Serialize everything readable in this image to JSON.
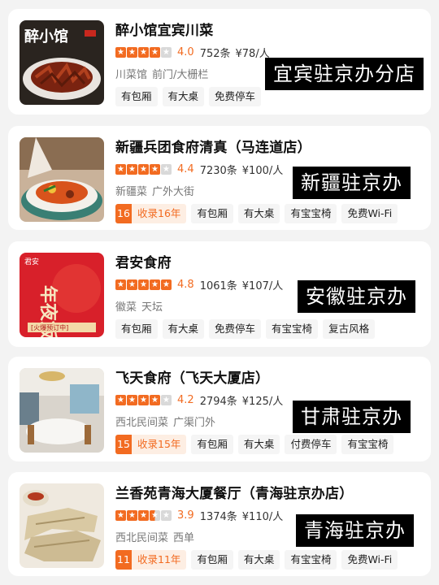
{
  "listings": [
    {
      "name": "醉小馆宜宾川菜",
      "stars": 4,
      "rating": "4.0",
      "reviews": "752条",
      "price": "¥78/人",
      "cuisine": "川菜馆",
      "area": "前门/大栅栏",
      "tags": [
        "有包厢",
        "有大桌",
        "免费停车"
      ],
      "banner": "宜宾驻京办分店",
      "thumb_text": "醉小馆"
    },
    {
      "name": "新疆兵团食府清真（马连道店）",
      "stars": 4,
      "rating": "4.4",
      "reviews": "7230条",
      "price": "¥100/人",
      "cuisine": "新疆菜",
      "area": "广外大街",
      "record_num": "16",
      "record_text": "收录16年",
      "tags": [
        "有包厢",
        "有大桌",
        "有宝宝椅",
        "免费Wi-Fi"
      ],
      "banner": "新疆驻京办"
    },
    {
      "name": "君安食府",
      "stars": 5,
      "rating": "4.8",
      "reviews": "1061条",
      "price": "¥107/人",
      "cuisine": "徽菜",
      "area": "天坛",
      "tags": [
        "有包厢",
        "有大桌",
        "免费停车",
        "有宝宝椅",
        "复古风格"
      ],
      "banner": "安徽驻京办",
      "thumb_text": "年夜飯",
      "thumb_badge": "君安",
      "thumb_caption": "[火爆预订中]"
    },
    {
      "name": "飞天食府（飞天大厦店）",
      "stars": 4,
      "rating": "4.2",
      "reviews": "2794条",
      "price": "¥125/人",
      "cuisine": "西北民间菜",
      "area": "广渠门外",
      "record_num": "15",
      "record_text": "收录15年",
      "tags": [
        "有包厢",
        "有大桌",
        "付费停车",
        "有宝宝椅"
      ],
      "banner": "甘肃驻京办"
    },
    {
      "name": "兰香苑青海大厦餐厅（青海驻京办店）",
      "stars": 3.5,
      "rating": "3.9",
      "reviews": "1374条",
      "price": "¥110/人",
      "cuisine": "西北民间菜",
      "area": "西单",
      "record_num": "11",
      "record_text": "收录11年",
      "tags": [
        "有包厢",
        "有大桌",
        "有宝宝椅",
        "免费Wi-Fi"
      ],
      "banner": "青海驻京办"
    }
  ],
  "colors": {
    "accent": "#f26b21",
    "star_empty": "#d9d9d9"
  }
}
